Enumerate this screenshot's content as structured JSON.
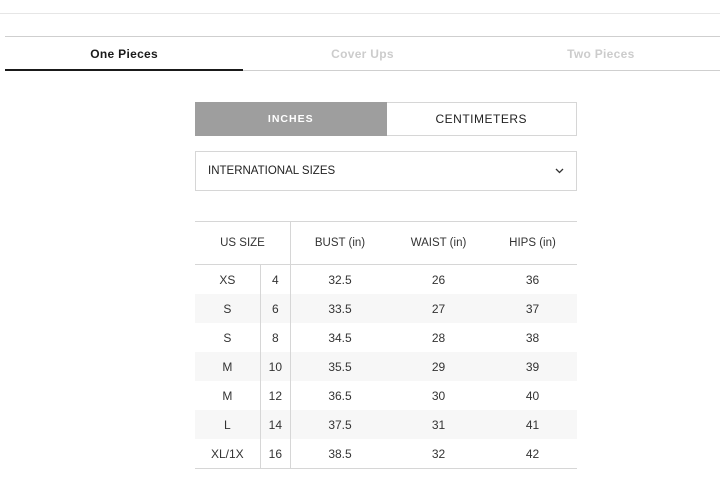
{
  "tabs": [
    {
      "label": "One Pieces",
      "active": true
    },
    {
      "label": "Cover Ups",
      "active": false
    },
    {
      "label": "Two Pieces",
      "active": false
    }
  ],
  "units": {
    "inches_label": "INCHES",
    "centimeters_label": "CENTIMETERS",
    "selected": "inches"
  },
  "size_system": {
    "value": "INTERNATIONAL SIZES",
    "chevron_icon": "chevron-down-icon"
  },
  "table": {
    "headers": {
      "us_size": "US SIZE",
      "bust": "BUST (in)",
      "waist": "WAIST (in)",
      "hips": "HIPS (in)"
    },
    "rows": [
      {
        "label": "XS",
        "num": "4",
        "bust": "32.5",
        "waist": "26",
        "hips": "36"
      },
      {
        "label": "S",
        "num": "6",
        "bust": "33.5",
        "waist": "27",
        "hips": "37"
      },
      {
        "label": "S",
        "num": "8",
        "bust": "34.5",
        "waist": "28",
        "hips": "38"
      },
      {
        "label": "M",
        "num": "10",
        "bust": "35.5",
        "waist": "29",
        "hips": "39"
      },
      {
        "label": "M",
        "num": "12",
        "bust": "36.5",
        "waist": "30",
        "hips": "40"
      },
      {
        "label": "L",
        "num": "14",
        "bust": "37.5",
        "waist": "31",
        "hips": "41"
      },
      {
        "label": "XL/1X",
        "num": "16",
        "bust": "38.5",
        "waist": "32",
        "hips": "42"
      }
    ]
  },
  "colors": {
    "selected_unit_bg": "#9e9e9e",
    "active_tab_text": "#1a1a1a",
    "inactive_tab_text": "#cccccc",
    "stripe": "#f7f7f7"
  }
}
